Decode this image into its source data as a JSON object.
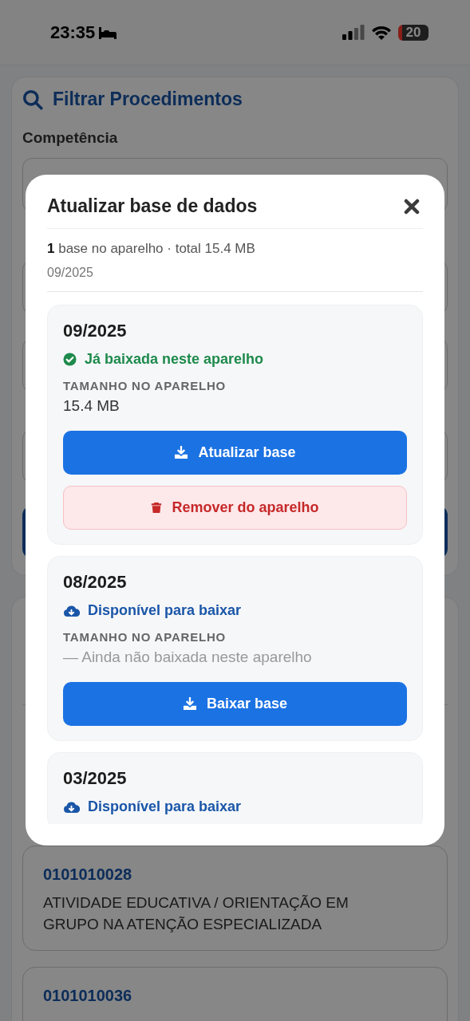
{
  "status_bar": {
    "time": "23:35",
    "battery": "20"
  },
  "filter_card": {
    "title": "Filtrar Procedimentos",
    "field_label": "Competência"
  },
  "procedures": [
    {
      "code": "0101010028",
      "description": "ATIVIDADE EDUCATIVA / ORIENTAÇÃO EM GRUPO NA ATENÇÃO ESPECIALIZADA"
    },
    {
      "code": "0101010036"
    }
  ],
  "modal": {
    "title": "Atualizar base de dados",
    "summary": "**1** base no aparelho · total 15.4 MB",
    "summary_detail": "09/2025",
    "bases": [
      {
        "period": "09/2025",
        "status": {
          "kind": "downloaded",
          "text": "Já baixada neste aparelho"
        },
        "size_label": "TAMANHO NO APARELHO",
        "size_value": "15.4 MB",
        "downloaded": true,
        "actions": [
          {
            "kind": "primary",
            "label": "Atualizar base"
          },
          {
            "kind": "danger",
            "label": "Remover do aparelho"
          }
        ]
      },
      {
        "period": "08/2025",
        "status": {
          "kind": "available",
          "text": "Disponível para baixar"
        },
        "size_label": "TAMANHO NO APARELHO",
        "size_value": "— Ainda não baixada neste aparelho",
        "downloaded": false,
        "actions": [
          {
            "kind": "primary",
            "label": "Baixar base"
          }
        ]
      },
      {
        "period": "03/2025",
        "status": {
          "kind": "available",
          "text": "Disponível para baixar"
        }
      }
    ]
  }
}
